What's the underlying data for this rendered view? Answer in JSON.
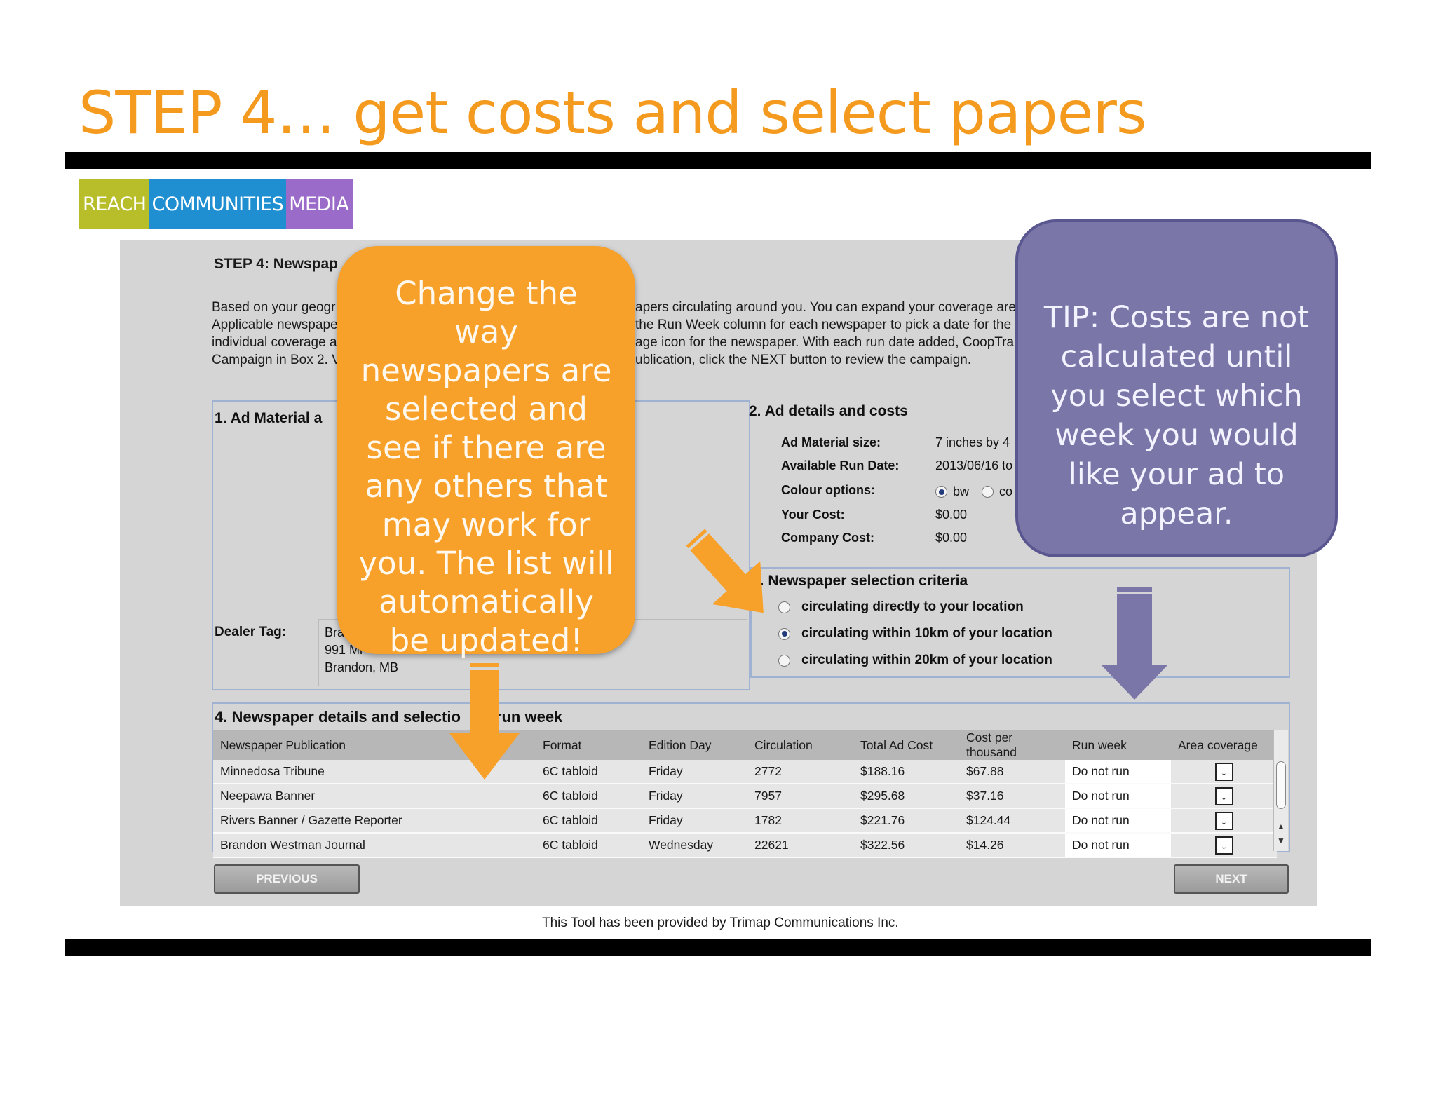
{
  "slide": {
    "title": "STEP 4… get costs and select papers",
    "footer": "This Tool has been provided by Trimap Communications Inc."
  },
  "logo": {
    "part1": "REACH",
    "part2": "COMMUNITIES",
    "part3": "MEDIA",
    "colors": {
      "part1": "#b8be2a",
      "part2": "#1f8fd1",
      "part3": "#9b6bc9"
    }
  },
  "tool": {
    "step_title": "STEP 4: Newspap",
    "intro_lines": [
      "Based on your geogr",
      "Applicable newspape",
      "individual coverage a",
      "Campaign in Box 2. V"
    ],
    "intro_right_lines": [
      "apers circulating around you. You can expand your coverage are",
      "the Run Week column for each newspaper to pick a date for the",
      "age icon for the newspaper. With each run date added, CoopTra",
      "ublication, click the NEXT button to review the campaign."
    ],
    "box1": {
      "title": "1. Ad Material a",
      "dealer_label": "Dealer Tag:",
      "dealer_lines": [
        "Bra",
        "991 Mi",
        "Brandon, MB"
      ]
    },
    "box2": {
      "title": "2. Ad details and costs",
      "rows": [
        {
          "label": "Ad Material size:",
          "value": "7 inches by 4"
        },
        {
          "label": "Available Run Date:",
          "value": "2013/06/16 to"
        },
        {
          "label": "Colour options:",
          "value": ""
        },
        {
          "label": "Your Cost:",
          "value": "$0.00"
        },
        {
          "label": "Company Cost:",
          "value": "$0.00"
        }
      ],
      "colour_opt1": "bw",
      "colour_opt2": "co"
    },
    "box3": {
      "title": "3. Newspaper selection criteria",
      "options": [
        "circulating directly to your location",
        "circulating within 10km of your location",
        "circulating within 20km of your location"
      ],
      "selected_index": 1
    },
    "box4": {
      "title_left": "4. Newspaper details and selectio",
      "title_right": "run week",
      "headers": [
        "Newspaper Publication",
        "Format",
        "Edition Day",
        "Circulation",
        "Total Ad Cost",
        "Cost per thousand",
        "Run week",
        "Area coverage"
      ],
      "rows": [
        [
          "Minnedosa Tribune",
          "6C tabloid",
          "Friday",
          "2772",
          "$188.16",
          "$67.88",
          "Do not run"
        ],
        [
          "Neepawa Banner",
          "6C tabloid",
          "Friday",
          "7957",
          "$295.68",
          "$37.16",
          "Do not run"
        ],
        [
          "Rivers Banner / Gazette Reporter",
          "6C tabloid",
          "Friday",
          "1782",
          "$221.76",
          "$124.44",
          "Do not run"
        ],
        [
          "Brandon Westman Journal",
          "6C tabloid",
          "Wednesday",
          "22621",
          "$322.56",
          "$14.26",
          "Do not run"
        ]
      ]
    },
    "buttons": {
      "previous": "PREVIOUS",
      "next": "NEXT"
    }
  },
  "callouts": {
    "orange": "Change the way newspapers are selected and see if there are any others that may work for you. The list will automatically be updated!",
    "purple": "TIP:  Costs are not calculated until you select which week you would like your ad to appear."
  },
  "colors": {
    "title": "#f39a1f",
    "orange_callout": "#f7a12a",
    "purple_callout": "#7b76a8"
  }
}
